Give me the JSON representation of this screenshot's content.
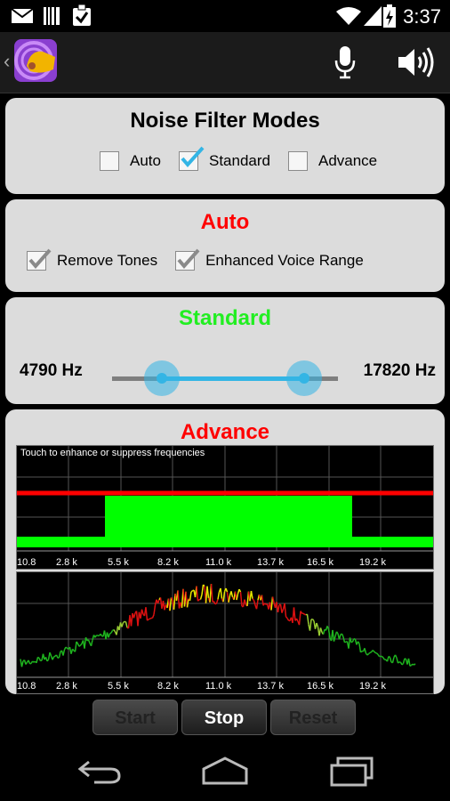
{
  "status_bar": {
    "time": "3:37",
    "icons": [
      "gmail-icon",
      "barcode-icon",
      "clipboard-check-icon",
      "wifi-icon",
      "signal-icon",
      "battery-charging-icon"
    ]
  },
  "action_bar": {
    "icons": [
      "app-logo-icon",
      "microphone-icon",
      "speaker-icon"
    ]
  },
  "modes_panel": {
    "title": "Noise Filter Modes",
    "options": [
      {
        "label": "Auto",
        "checked": false
      },
      {
        "label": "Standard",
        "checked": true
      },
      {
        "label": "Advance",
        "checked": false
      }
    ]
  },
  "auto_panel": {
    "title": "Auto",
    "title_color": "#ff0000",
    "options": [
      {
        "label": "Remove Tones",
        "checked": true
      },
      {
        "label": "Enhanced Voice Range",
        "checked": true
      }
    ]
  },
  "standard_panel": {
    "title": "Standard",
    "title_color": "#22ee22",
    "low_label": "4790 Hz",
    "high_label": "17820 Hz",
    "range_low_fraction": 0.22,
    "range_high_fraction": 0.85
  },
  "advance_panel": {
    "title": "Advance",
    "title_color": "#ff0000",
    "filter_graph": {
      "hint": "Touch to enhance or suppress frequencies",
      "ticks": [
        "10.8",
        "2.8 k",
        "5.5 k",
        "8.2 k",
        "11.0 k",
        "13.7 k",
        "16.5 k",
        "19.2 k"
      ]
    },
    "spectrum_graph": {
      "ticks": [
        "10.8",
        "2.8 k",
        "5.5 k",
        "8.2 k",
        "11.0 k",
        "13.7 k",
        "16.5 k",
        "19.2 k"
      ]
    }
  },
  "buttons": {
    "start": "Start",
    "stop": "Stop",
    "reset": "Reset"
  },
  "nav_bar": {
    "icons": [
      "back-icon",
      "home-icon",
      "recent-apps-icon"
    ]
  }
}
